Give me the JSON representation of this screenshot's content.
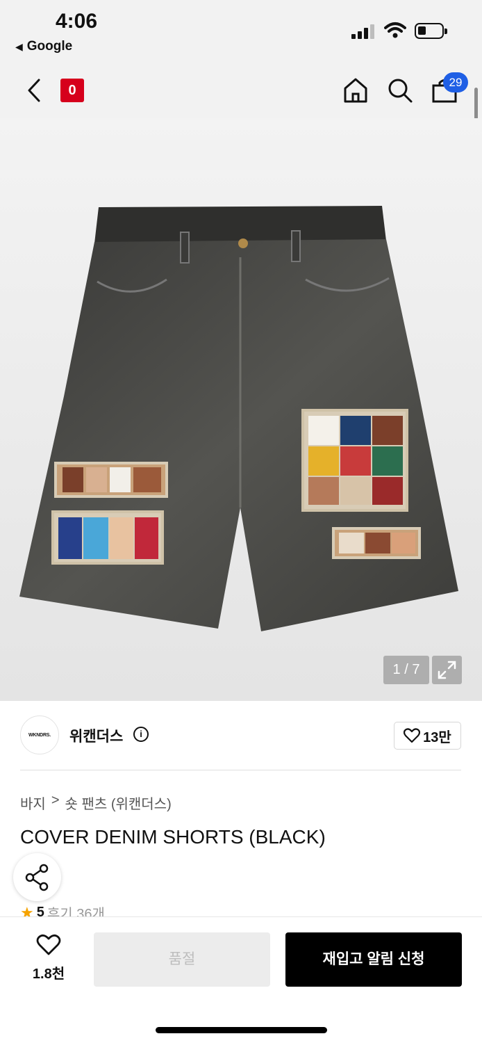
{
  "status_bar": {
    "time": "4:06",
    "back_app": "Google"
  },
  "header": {
    "logo_text": "0",
    "cart_count": "29"
  },
  "gallery": {
    "counter": "1 / 7"
  },
  "brand": {
    "logo_text": "WKNDRS.",
    "name": "위캔더스",
    "likes": "13만"
  },
  "breadcrumb": {
    "category": "바지",
    "separator": ">",
    "subcategory": "숏 팬츠 (위캔더스)"
  },
  "product": {
    "title": "COVER DENIM SHORTS (BLACK)",
    "rating": "5",
    "reviews": "후기 36개"
  },
  "bottom_bar": {
    "wish_count": "1.8천",
    "soldout_label": "품절",
    "restock_label": "재입고 알림 신청"
  },
  "colors": {
    "brand_red": "#d6001c",
    "badge_blue": "#1f5fe5",
    "star": "#f5a300"
  }
}
